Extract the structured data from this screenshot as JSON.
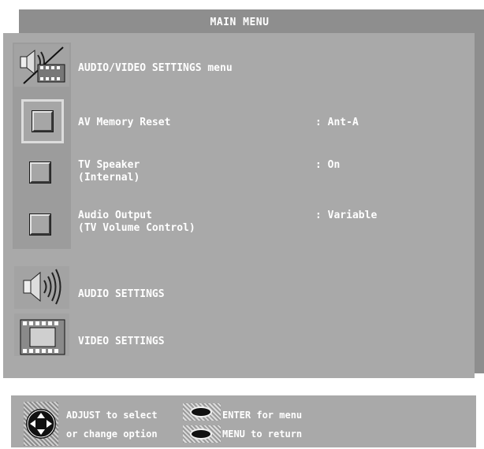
{
  "window": {
    "title": "MAIN MENU"
  },
  "menu": {
    "header": {
      "label": "AUDIO/VIDEO SETTINGS menu",
      "icon": "speaker-film-icon"
    },
    "items": [
      {
        "label": "AV Memory Reset",
        "value": ": Ant-A",
        "selected": true
      },
      {
        "label": "TV Speaker",
        "sublabel": "(Internal)",
        "value": ": On"
      },
      {
        "label": "Audio Output",
        "sublabel": "(TV Volume Control)",
        "value": ": Variable"
      }
    ],
    "links": [
      {
        "label": "AUDIO SETTINGS",
        "icon": "speaker-icon"
      },
      {
        "label": "VIDEO SETTINGS",
        "icon": "film-strip-icon"
      }
    ]
  },
  "footer": {
    "adjust_line1": "ADJUST to select",
    "adjust_line2": "or change option",
    "enter_text": "ENTER for menu",
    "menu_text": "MENU  to  return"
  }
}
